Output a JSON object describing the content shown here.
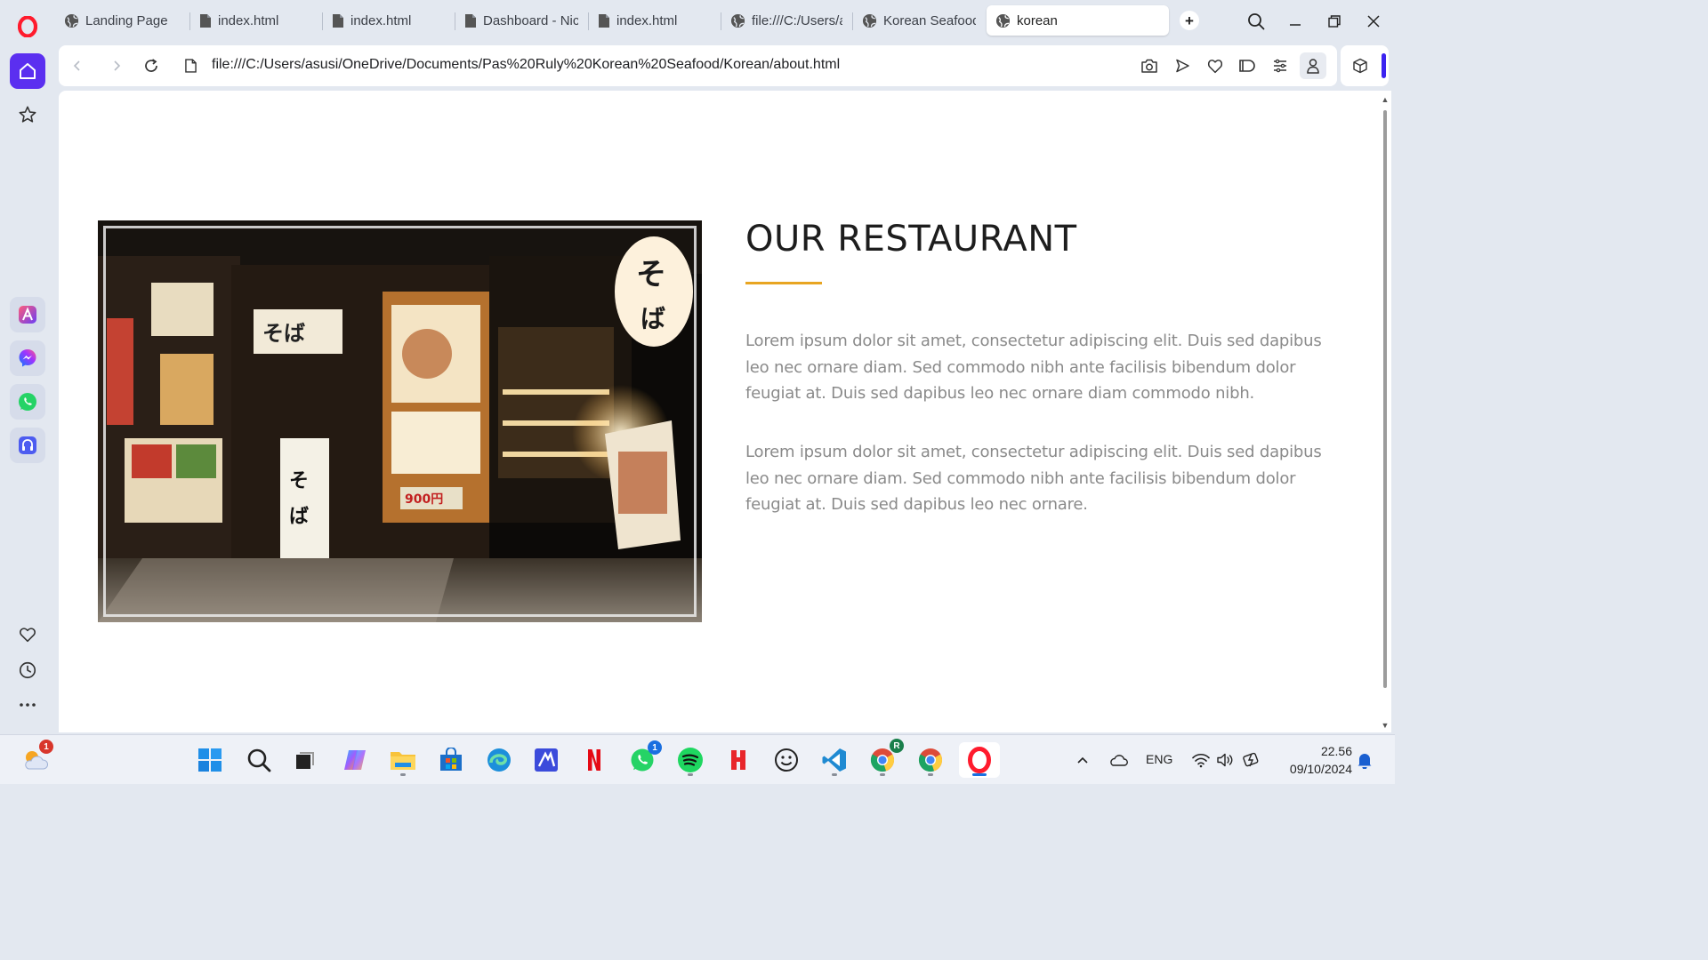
{
  "browser": {
    "tabs": [
      {
        "title": "Landing Page",
        "icon": "globe-icon"
      },
      {
        "title": "index.html",
        "icon": "file-icon"
      },
      {
        "title": "index.html",
        "icon": "file-icon"
      },
      {
        "title": "Dashboard - Nice",
        "icon": "file-icon"
      },
      {
        "title": "index.html",
        "icon": "file-icon"
      },
      {
        "title": "file:///C:/Users/asusi",
        "icon": "globe-icon"
      },
      {
        "title": "Korean Seafood",
        "icon": "globe-icon"
      },
      {
        "title": "korean",
        "icon": "globe-icon",
        "active": true
      }
    ],
    "new_tab_label": "+",
    "url": "file:///C:/Users/asusi/OneDrive/Documents/Pas%20Ruly%20Korean%20Seafood/Korean/about.html",
    "accent_color": "#5b2ff0"
  },
  "page": {
    "title": "OUR RESTAURANT",
    "underline_color": "#e8a522",
    "paragraphs": [
      "Lorem ipsum dolor sit amet, consectetur adipiscing elit. Duis sed dapibus leo nec ornare diam. Sed commodo nibh ante facilisis bibendum dolor feugiat at. Duis sed dapibus leo nec ornare diam commodo nibh.",
      "Lorem ipsum dolor sit amet, consectetur adipiscing elit. Duis sed dapibus leo nec ornare diam. Sed commodo nibh ante facilisis bibendum dolor feugiat at. Duis sed dapibus leo nec ornare."
    ]
  },
  "taskbar": {
    "weather_badge": "1",
    "whatsapp_badge": "1",
    "chrome_profile_letter": "R",
    "language": "ENG",
    "time": "22.56",
    "date": "09/10/2024"
  }
}
